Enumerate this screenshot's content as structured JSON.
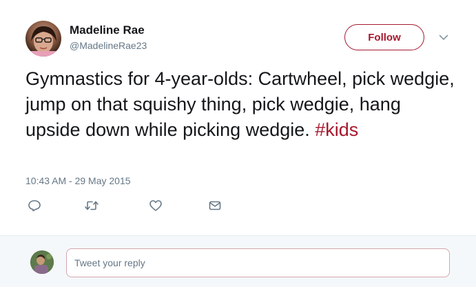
{
  "author": {
    "display_name": "Madeline Rae",
    "handle": "@MadelineRae23"
  },
  "header": {
    "follow_label": "Follow"
  },
  "tweet": {
    "text": "Gymnastics for 4-year-olds: Cartwheel, pick wedgie, jump on that squishy thing, pick wedgie, hang upside down while picking wedgie.",
    "hashtag": "#kids",
    "timestamp": "10:43 AM - 29 May 2015"
  },
  "actions": [
    "reply-icon",
    "retweet-icon",
    "like-icon",
    "message-icon"
  ],
  "reply": {
    "placeholder": "Tweet your reply"
  },
  "colors": {
    "accent": "#a6192e",
    "text_primary": "#14171a",
    "text_secondary": "#657786",
    "reply_bar_bg": "#f5f8fa"
  }
}
